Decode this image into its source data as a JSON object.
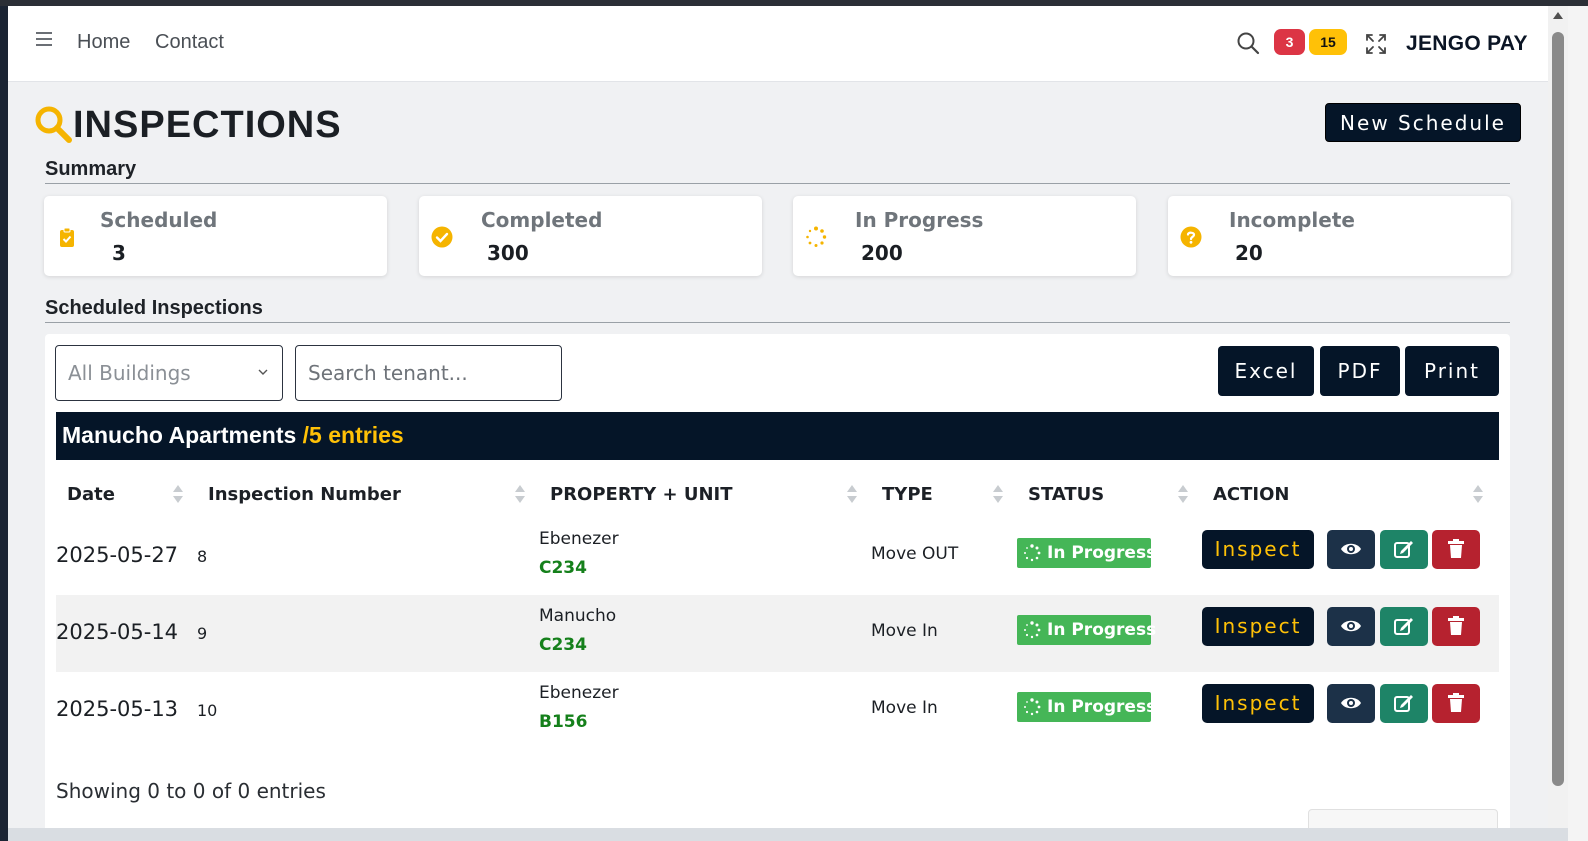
{
  "navbar": {
    "links": [
      "Home",
      "Contact"
    ],
    "badges": {
      "alerts": "3",
      "notifications": "15"
    },
    "brand": "JENGO PAY"
  },
  "page": {
    "title": "INSPECTIONS",
    "new_schedule_label": "New Schedule"
  },
  "summary": {
    "heading": "Summary",
    "cards": [
      {
        "label": "Scheduled",
        "value": "3",
        "icon": "clipboard-check-icon"
      },
      {
        "label": "Completed",
        "value": "300",
        "icon": "check-circle-icon"
      },
      {
        "label": "In Progress",
        "value": "200",
        "icon": "spinner-icon"
      },
      {
        "label": "Incomplete",
        "value": "20",
        "icon": "question-circle-icon"
      }
    ]
  },
  "scheduled": {
    "heading": "Scheduled Inspections",
    "filter_selected": "All Buildings",
    "search_placeholder": "Search tenant...",
    "export_buttons": [
      "Excel",
      "PDF",
      "Print"
    ],
    "group": {
      "name": "Manucho Apartments",
      "count": "/5 entries"
    },
    "columns": [
      "Date",
      "Inspection Number",
      "PROPERTY + UNIT",
      "TYPE",
      "STATUS",
      "ACTION"
    ],
    "rows": [
      {
        "date": "2025-05-27",
        "number": "8",
        "property": "Ebenezer",
        "unit": "C234",
        "type": "Move OUT",
        "status": "In Progress",
        "action": "Inspect"
      },
      {
        "date": "2025-05-14",
        "number": "9",
        "property": "Manucho",
        "unit": "C234",
        "type": "Move In",
        "status": "In Progress",
        "action": "Inspect"
      },
      {
        "date": "2025-05-13",
        "number": "10",
        "property": "Ebenezer",
        "unit": "B156",
        "type": "Move In",
        "status": "In Progress",
        "action": "Inspect"
      }
    ],
    "footer_info": "Showing 0 to 0 of 0 entries"
  },
  "colors": {
    "navy": "#051528",
    "accent_yellow": "#ffc107",
    "status_green": "#45b657",
    "unit_green": "#15801b",
    "danger_red": "#b6222f",
    "edit_teal": "#1e8467"
  }
}
